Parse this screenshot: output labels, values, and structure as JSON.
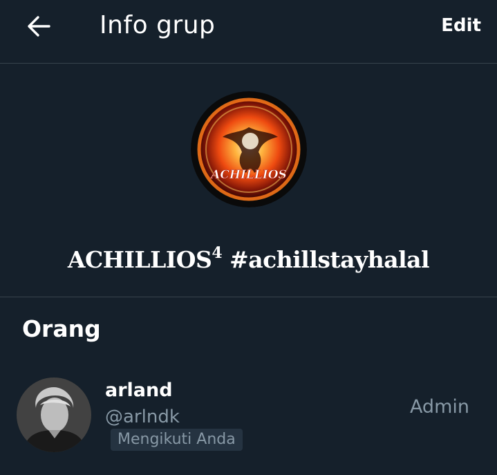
{
  "header": {
    "back_icon": "arrow-left-icon",
    "title": "Info grup",
    "edit_label": "Edit"
  },
  "group": {
    "avatar_text": "ACHILLIOS",
    "name": "ACHILLIOS",
    "name_sup": "4",
    "name_suffix": " #achillstayhalal"
  },
  "members_section": {
    "heading": "Orang",
    "members": [
      {
        "name": "arland",
        "handle": "@arlndk",
        "follow_status": "Mengikuti Anda",
        "role": "Admin"
      }
    ]
  },
  "colors": {
    "background": "#15202b",
    "divider": "#38444d",
    "secondary_text": "#8899a6",
    "badge_bg": "#253341"
  }
}
